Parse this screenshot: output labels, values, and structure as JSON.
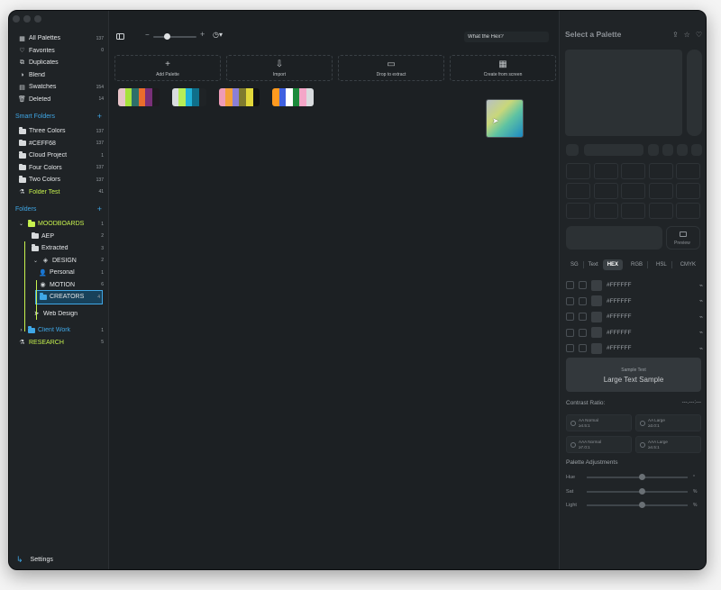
{
  "sidebar": {
    "library": [
      {
        "label": "All Palettes",
        "count": "137",
        "icon": "grid-icon"
      },
      {
        "label": "Favorites",
        "count": "0",
        "icon": "heart-icon"
      },
      {
        "label": "Duplicates",
        "count": "",
        "icon": "duplicate-icon"
      },
      {
        "label": "Blend",
        "count": "",
        "icon": "blend-icon"
      },
      {
        "label": "Swatches",
        "count": "154",
        "icon": "swatch-icon"
      },
      {
        "label": "Deleted",
        "count": "14",
        "icon": "trash-icon"
      }
    ],
    "smart_folders_title": "Smart Folders",
    "smart_folders": [
      {
        "label": "Three Colors",
        "count": "137"
      },
      {
        "label": "#CEFF68",
        "count": "137"
      },
      {
        "label": "Cloud Project",
        "count": "1"
      },
      {
        "label": "Four Colors",
        "count": "137"
      },
      {
        "label": "Two Colors",
        "count": "137"
      },
      {
        "label": "Folder Test",
        "count": "41"
      }
    ],
    "folders_title": "Folders",
    "folders": [
      {
        "label": "MOODBOARDS",
        "count": "1"
      },
      {
        "label": "AEP",
        "count": "2"
      },
      {
        "label": "Extracted",
        "count": "3"
      },
      {
        "label": "DESIGN",
        "count": "2"
      },
      {
        "label": "Personal",
        "count": "1"
      },
      {
        "label": "MOTION",
        "count": "6"
      },
      {
        "label": "CREATORS",
        "count": "4"
      },
      {
        "label": "Web Design",
        "count": ""
      },
      {
        "label": "Client Work",
        "count": "1"
      },
      {
        "label": "RESEARCH",
        "count": "5"
      }
    ],
    "settings_label": "Settings"
  },
  "toolbar": {
    "search_value": "What the Hex?"
  },
  "actions": [
    {
      "label": "Add Palette",
      "icon": "plus-icon"
    },
    {
      "label": "Import",
      "icon": "import-icon"
    },
    {
      "label": "Drop to extract",
      "icon": "image-icon"
    },
    {
      "label": "Create from screen",
      "icon": "screen-grid-icon"
    }
  ],
  "palettes": [
    [
      "#e7c3c8",
      "#a6e23b",
      "#2d6f6a",
      "#ea6d2c",
      "#7a2f78",
      "#1e1b1f"
    ],
    [
      "#d9dcdf",
      "#b7ee57",
      "#20b1d8",
      "#0f6f8a",
      "#1f2326"
    ],
    [
      "#ee9bb7",
      "#f3a13a",
      "#8b7fd6",
      "#7f7b2e",
      "#e1d73a",
      "#101214"
    ],
    [
      "#ff9a1f",
      "#3f60e0",
      "#ffffff",
      "#1d8a3c",
      "#f4a6c8",
      "#d8dbde"
    ]
  ],
  "inspector": {
    "title": "Select a Palette",
    "format_tabs": [
      "SG",
      "Text",
      "HEX",
      "RGB",
      "HSL",
      "CMYK"
    ],
    "active_format": "HEX",
    "preview_label": "Preview",
    "hex_values": [
      "#FFFFFF",
      "#FFFFFF",
      "#FFFFFF",
      "#FFFFFF",
      "#FFFFFF"
    ],
    "sample_label": "Sample Text",
    "sample_text": "Large Text Sample",
    "contrast_title": "Contrast Ratio:",
    "contrast_value": "---.---:---",
    "contrast_checks": [
      {
        "name": "AA Normal",
        "req": "≥4.5:1"
      },
      {
        "name": "AA Large",
        "req": "≥3.0:1"
      },
      {
        "name": "AAA Normal",
        "req": "≥7.0:1"
      },
      {
        "name": "AAA Large",
        "req": "≥4.5:1"
      }
    ],
    "adjust_title": "Palette Adjustments",
    "adjustments": [
      {
        "label": "Hue",
        "unit": "°"
      },
      {
        "label": "Sat",
        "unit": "%"
      },
      {
        "label": "Light",
        "unit": "%"
      }
    ]
  },
  "colors": {
    "accent_blue": "#3fa7e6",
    "accent_green": "#c7f24e"
  }
}
